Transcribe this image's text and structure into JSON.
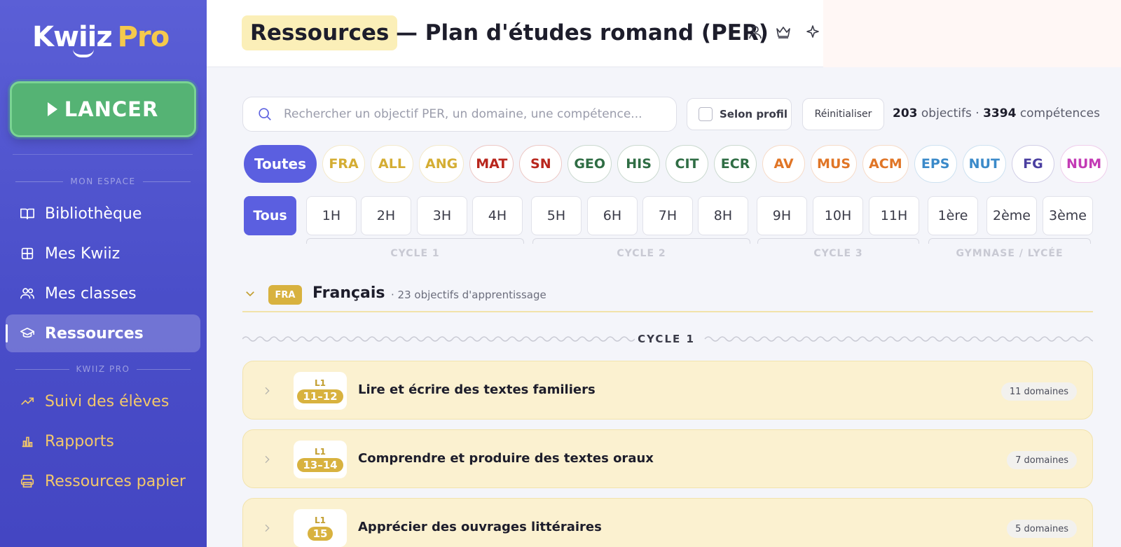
{
  "sidebar": {
    "logo_main": "Kwiiz",
    "logo_accent": "Pro",
    "launch_label": "LANCER",
    "section_mon_espace": "MON ESPACE",
    "section_kwiiz_pro": "KWIIZ PRO",
    "items": [
      {
        "label": "Bibliothèque",
        "icon": "book-icon"
      },
      {
        "label": "Mes Kwiiz",
        "icon": "grid-icon"
      },
      {
        "label": "Mes classes",
        "icon": "users-icon"
      },
      {
        "label": "Ressources",
        "icon": "graduation-cap-icon",
        "active": true
      }
    ],
    "pro_items": [
      {
        "label": "Suivi des élèves",
        "icon": "trending-up-icon"
      },
      {
        "label": "Rapports",
        "icon": "bar-chart-icon"
      },
      {
        "label": "Ressources papier",
        "icon": "printer-icon"
      }
    ]
  },
  "header": {
    "title_highlight": "Ressources",
    "title_rest": "— Plan d'études romand (PER)",
    "icons": [
      "user-icon",
      "crown-icon",
      "sparkle-icon"
    ]
  },
  "filters": {
    "search_placeholder": "Rechercher un objectif PER, un domaine, une compétence...",
    "profile_label": "Selon profil",
    "reset_label": "Réinitialiser",
    "objectives_count": "203",
    "objectives_label": "objectifs ·",
    "skills_count": "3394",
    "skills_label": "compétences"
  },
  "subjects": [
    {
      "label": "Toutes",
      "color": "#ffffff",
      "active": true
    },
    {
      "label": "FRA",
      "color": "#d4ad33"
    },
    {
      "label": "ALL",
      "color": "#d4ad33"
    },
    {
      "label": "ANG",
      "color": "#d4ad33"
    },
    {
      "label": "MAT",
      "color": "#b8261d"
    },
    {
      "label": "SN",
      "color": "#b8261d"
    },
    {
      "label": "GEO",
      "color": "#2f6d44"
    },
    {
      "label": "HIS",
      "color": "#2f6d44"
    },
    {
      "label": "CIT",
      "color": "#2f6d44"
    },
    {
      "label": "ECR",
      "color": "#2f6d44"
    },
    {
      "label": "AV",
      "color": "#e07526"
    },
    {
      "label": "MUS",
      "color": "#e07526"
    },
    {
      "label": "ACM",
      "color": "#e07526"
    },
    {
      "label": "EPS",
      "color": "#3b8ac9"
    },
    {
      "label": "NUT",
      "color": "#3b8ac9"
    },
    {
      "label": "FG",
      "color": "#4a3fa0"
    },
    {
      "label": "NUM",
      "color": "#c33bb5"
    }
  ],
  "levels": [
    "Tous",
    "1H",
    "2H",
    "3H",
    "4H",
    "5H",
    "6H",
    "7H",
    "8H",
    "9H",
    "10H",
    "11H",
    "1ère",
    "2ème",
    "3ème"
  ],
  "cycles": [
    "CYCLE 1",
    "CYCLE 2",
    "CYCLE 3",
    "GYMNASE / LYCÉE"
  ],
  "section": {
    "badge": "FRA",
    "title": "Français",
    "count": "· 23 objectifs d'apprentissage",
    "cycle_label": "CYCLE 1"
  },
  "objectives": [
    {
      "code_top": "L1",
      "code_range": "11–12",
      "title": "Lire et écrire des textes familiers",
      "domains": "11 domaines"
    },
    {
      "code_top": "L1",
      "code_range": "13–14",
      "title": "Comprendre et produire des textes oraux",
      "domains": "7 domaines"
    },
    {
      "code_top": "L1",
      "code_range": "15",
      "title": "Apprécier des ouvrages littéraires",
      "domains": "5 domaines"
    }
  ]
}
